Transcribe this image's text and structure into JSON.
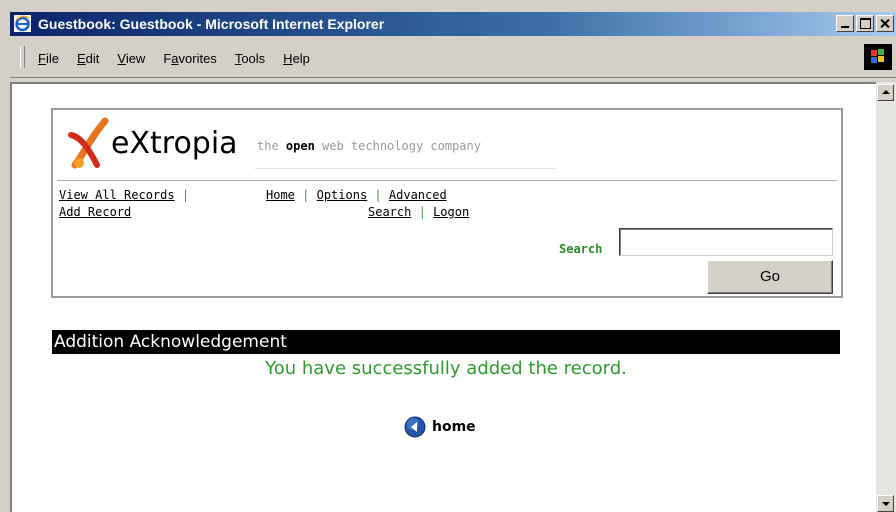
{
  "window": {
    "title": "Guestbook: Guestbook - Microsoft Internet Explorer"
  },
  "menu": [
    {
      "label": "File",
      "accel": "F"
    },
    {
      "label": "Edit",
      "accel": "E"
    },
    {
      "label": "View",
      "accel": "V"
    },
    {
      "label": "Favorites",
      "accel": "a"
    },
    {
      "label": "Tools",
      "accel": "T"
    },
    {
      "label": "Help",
      "accel": "H"
    }
  ],
  "page": {
    "logo": {
      "brand": "eXtropia",
      "tagline_pre": "the ",
      "tagline_bold": "open",
      "tagline_post": " web technology company"
    },
    "nav": {
      "view_all": "View All Records",
      "add_record": "Add Record",
      "home": "Home",
      "options": "Options",
      "advanced": "Advanced",
      "search": "Search",
      "logon": "Logon",
      "separator": "|"
    },
    "search": {
      "label": "Search",
      "value": "",
      "button": "Go"
    },
    "ack_title": "Addition Acknowledgement",
    "message": "You have successfully added the record.",
    "home_link": "home"
  },
  "colors": {
    "success_green": "#2e9a2e",
    "title_bar": "#0a246a",
    "logo_orange": "#f08a1c",
    "logo_red": "#d42a1c"
  }
}
